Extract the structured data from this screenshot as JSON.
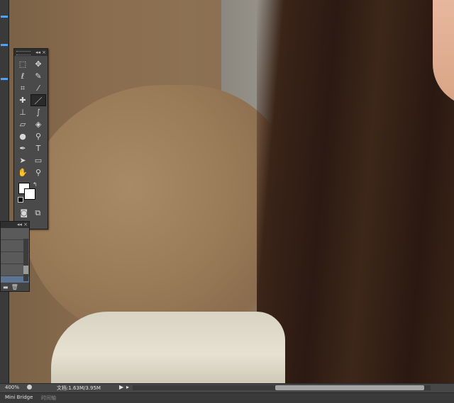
{
  "status_bar": {
    "zoom": "400%",
    "doc_info": "文档:1.63M/3.95M",
    "play_glyph": "▶",
    "more_glyph": "▸"
  },
  "bottom_tabs": {
    "items": [
      {
        "label": "Mini Bridge",
        "active": true
      },
      {
        "label": "时间轴",
        "active": false
      }
    ]
  },
  "tools_panel": {
    "header_collapse": "◂◂",
    "header_close": "×",
    "swap_glyph": "↰",
    "tools": [
      {
        "icon": "marquee-icon",
        "glyph": "⬚"
      },
      {
        "icon": "move-icon",
        "glyph": "✥"
      },
      {
        "icon": "lasso-icon",
        "glyph": "ℓ"
      },
      {
        "icon": "quick-selection-icon",
        "glyph": "✎"
      },
      {
        "icon": "crop-icon",
        "glyph": "⌗"
      },
      {
        "icon": "eyedropper-icon",
        "glyph": "⁄"
      },
      {
        "icon": "healing-brush-icon",
        "glyph": "✚"
      },
      {
        "icon": "brush-icon",
        "glyph": "／"
      },
      {
        "icon": "clone-stamp-icon",
        "glyph": "⊥"
      },
      {
        "icon": "history-brush-icon",
        "glyph": "∫"
      },
      {
        "icon": "eraser-icon",
        "glyph": "▱"
      },
      {
        "icon": "paint-bucket-icon",
        "glyph": "◈"
      },
      {
        "icon": "blur-icon",
        "glyph": "●"
      },
      {
        "icon": "dodge-icon",
        "glyph": "⚲"
      },
      {
        "icon": "pen-icon",
        "glyph": "✒"
      },
      {
        "icon": "type-icon",
        "glyph": "T"
      },
      {
        "icon": "path-selection-icon",
        "glyph": "➤"
      },
      {
        "icon": "rectangle-shape-icon",
        "glyph": "▭"
      },
      {
        "icon": "hand-icon",
        "glyph": "✋"
      },
      {
        "icon": "zoom-icon",
        "glyph": "⚲"
      }
    ],
    "bottom_icons": [
      {
        "icon": "quick-mask-icon",
        "glyph": "◙"
      },
      {
        "icon": "screen-mode-icon",
        "glyph": "⧉"
      }
    ],
    "foreground_color": "#ffffff",
    "background_color": "#ffffff",
    "active_tool_index": 7
  },
  "layers_panel": {
    "header_controls": "◂◂ ×",
    "footer_icons": [
      {
        "icon": "folder-icon",
        "glyph": "▬"
      },
      {
        "icon": "trash-icon",
        "glyph": "🗑"
      }
    ]
  },
  "colors": {
    "ui_dark": "#474747",
    "accent": "#4aa3ff",
    "selected_layer": "#5d7590"
  }
}
